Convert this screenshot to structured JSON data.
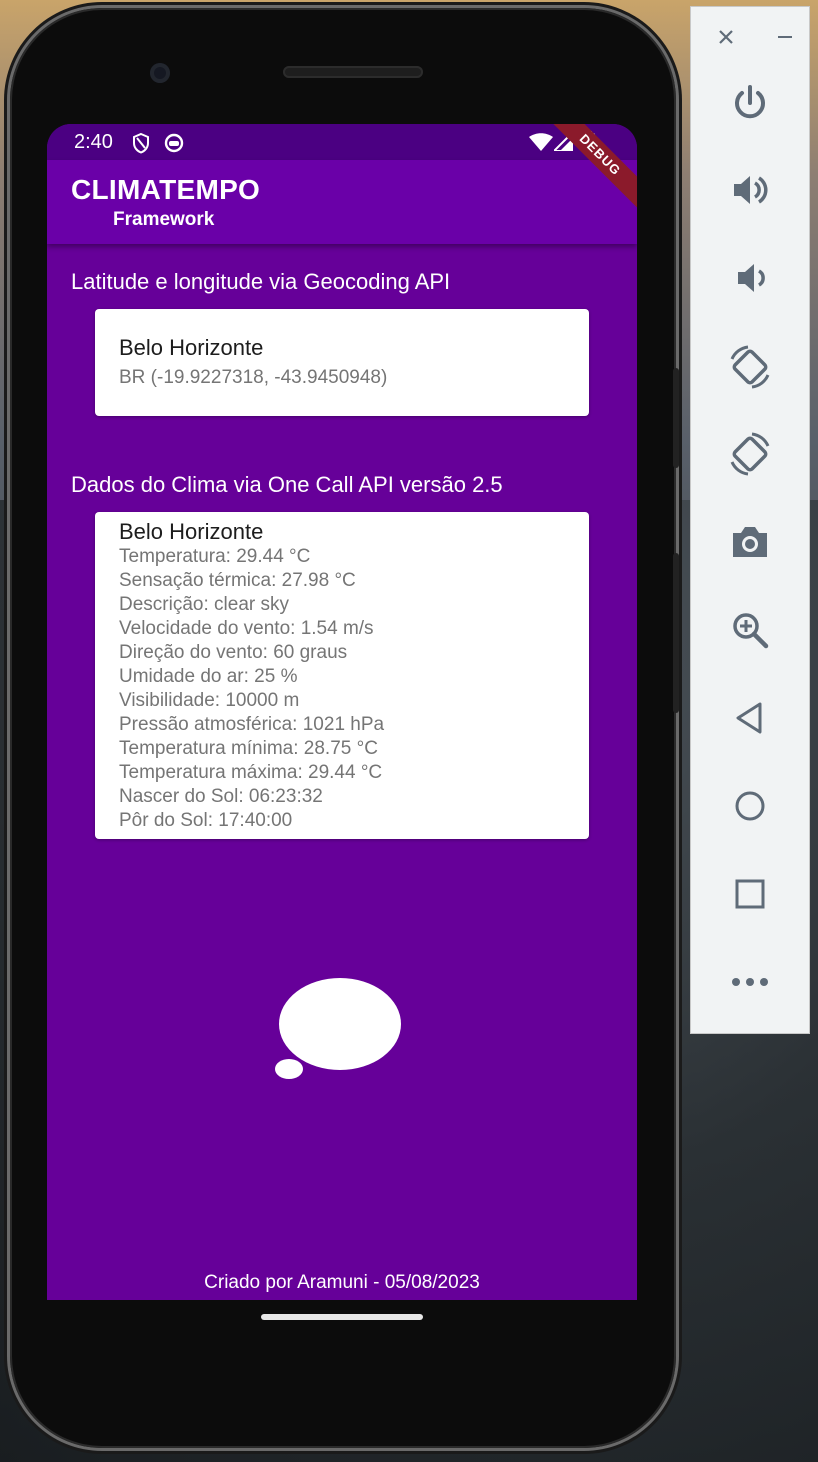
{
  "status_bar": {
    "time": "2:40"
  },
  "debug_banner": "DEBUG",
  "app_bar": {
    "title": "CLIMATEMPO",
    "subtitle": "Framework"
  },
  "geocoding": {
    "heading": "Latitude e longitude via Geocoding API",
    "city": "Belo Horizonte",
    "coords": "BR (-19.9227318, -43.9450948)"
  },
  "weather": {
    "heading": "Dados do Clima via One Call API versão 2.5",
    "city": "Belo Horizonte",
    "lines": [
      "Temperatura: 29.44 °C",
      "Sensação térmica: 27.98 °C",
      "Descrição: clear sky",
      "Velocidade do vento: 1.54 m/s",
      "Direção do vento: 60 graus",
      "Umidade do ar: 25 %",
      "Visibilidade: 10000 m",
      "Pressão atmosférica: 1021 hPa",
      "Temperatura mínima: 28.75 °C",
      "Temperatura máxima: 29.44 °C",
      "Nascer do Sol: 06:23:32",
      "Pôr do Sol: 17:40:00"
    ]
  },
  "footer": "Criado por Aramuni - 05/08/2023",
  "emulator_panel": {
    "tools": [
      "close-icon",
      "minimize-icon",
      "power-icon",
      "volume-up-icon",
      "volume-down-icon",
      "rotate-left-icon",
      "rotate-right-icon",
      "camera-icon",
      "zoom-icon",
      "back-icon",
      "home-icon",
      "overview-icon",
      "more-icon"
    ]
  },
  "colors": {
    "app_background": "#660099",
    "status_bar": "#4b0082",
    "app_bar": "#6a00a8"
  }
}
